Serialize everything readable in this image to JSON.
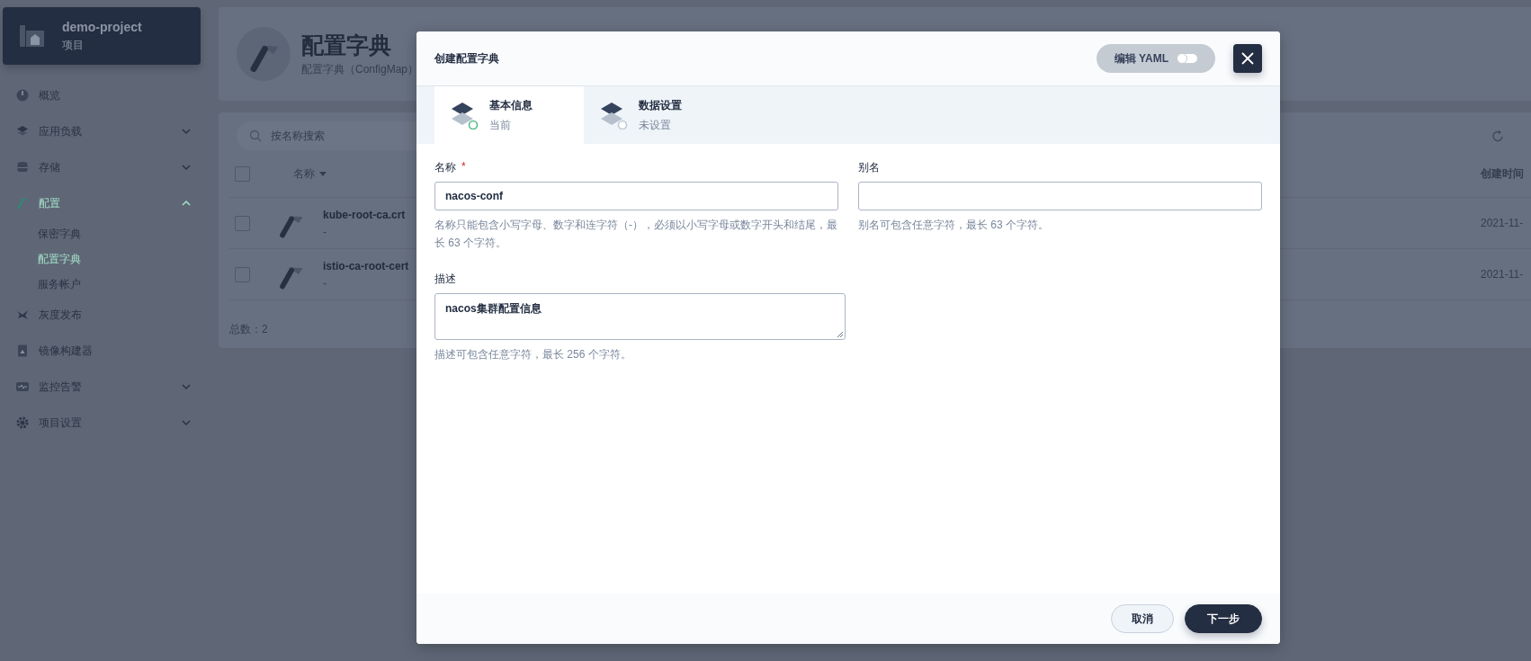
{
  "sidebar": {
    "project": {
      "name": "demo-project",
      "type": "项目"
    },
    "items": [
      {
        "label": "概览",
        "kind": "link",
        "selected": false
      },
      {
        "label": "应用负载",
        "kind": "group",
        "expanded": false,
        "selected": false
      },
      {
        "label": "存储",
        "kind": "group",
        "expanded": false,
        "selected": false
      },
      {
        "label": "配置",
        "kind": "group",
        "expanded": true,
        "selected": true,
        "children": [
          {
            "label": "保密字典",
            "selected": false
          },
          {
            "label": "配置字典",
            "selected": true
          },
          {
            "label": "服务帐户",
            "selected": false
          }
        ]
      },
      {
        "label": "灰度发布",
        "kind": "link",
        "selected": false
      },
      {
        "label": "镜像构建器",
        "kind": "link",
        "selected": false
      },
      {
        "label": "监控告警",
        "kind": "group",
        "expanded": false,
        "selected": false
      },
      {
        "label": "项目设置",
        "kind": "group",
        "expanded": false,
        "selected": false
      }
    ]
  },
  "page_header": {
    "title": "配置字典",
    "subtitle": "配置字典（ConfigMap）"
  },
  "search": {
    "placeholder": "按名称搜索"
  },
  "table": {
    "columns": [
      "名称",
      "创建时间"
    ],
    "select_all": {
      "checked": false
    },
    "rows": [
      {
        "name": "kube-root-ca.crt",
        "description": "-",
        "created": "2021-11-",
        "checked": false
      },
      {
        "name": "istio-ca-root-cert",
        "description": "-",
        "created": "2021-11-",
        "checked": false
      }
    ],
    "total": "总数：2"
  },
  "dialog": {
    "title": "创建配置字典",
    "yaml_toggle": {
      "label": "编辑 YAML",
      "on": false
    },
    "steps": [
      {
        "title": "基本信息",
        "status": "当前",
        "selected": true
      },
      {
        "title": "数据设置",
        "status": "未设置",
        "selected": false
      }
    ],
    "fields": [
      {
        "kind": "input",
        "label": "名称",
        "required_mark": "*",
        "value": "nacos-conf",
        "hint": "名称只能包含小写字母、数字和连字符（-），必须以小写字母或数字开头和结尾，最长 63 个字符。"
      },
      {
        "kind": "input",
        "label": "别名",
        "hint": "别名可包含任意字符，最长 63 个字符。"
      },
      {
        "kind": "textarea",
        "label": "描述",
        "value": "nacos集群配置信息",
        "hint": "描述可包含任意字符，最长 256 个字符。"
      }
    ],
    "buttons": [
      {
        "label": "取消",
        "kind": "secondary"
      },
      {
        "label": "下一步",
        "kind": "primary"
      }
    ]
  }
}
